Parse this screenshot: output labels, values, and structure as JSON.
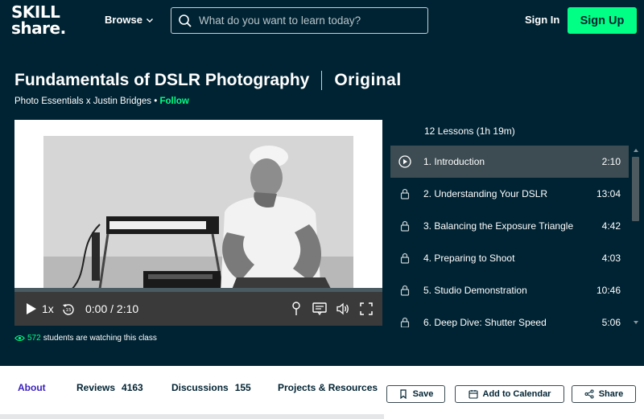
{
  "header": {
    "logo_line1": "SKILL",
    "logo_line2": "share.",
    "browse_label": "Browse",
    "search_placeholder": "What do you want to learn today?",
    "signin_label": "Sign In",
    "signup_label": "Sign Up"
  },
  "course": {
    "title": "Fundamentals of DSLR Photography",
    "badge": "Original",
    "byline": "Photo Essentials x Justin Bridges",
    "byline_sep": " • ",
    "follow_label": "Follow"
  },
  "player": {
    "speed": "1x",
    "current_time": "0:00",
    "time_sep": " / ",
    "duration": "2:10",
    "progress_fraction": 0.0
  },
  "lessons": {
    "header": "12 Lessons (1h 19m)",
    "items": [
      {
        "label": "1. Introduction",
        "duration": "2:10",
        "state": "playable"
      },
      {
        "label": "2. Understanding Your DSLR",
        "duration": "13:04",
        "state": "locked"
      },
      {
        "label": "3. Balancing the Exposure Triangle",
        "duration": "4:42",
        "state": "locked"
      },
      {
        "label": "4. Preparing to Shoot",
        "duration": "4:03",
        "state": "locked"
      },
      {
        "label": "5. Studio Demonstration",
        "duration": "10:46",
        "state": "locked"
      },
      {
        "label": "6. Deep Dive: Shutter Speed",
        "duration": "5:06",
        "state": "locked"
      }
    ]
  },
  "watching": {
    "count": "572",
    "text": "students are watching this class"
  },
  "tabs": [
    {
      "label": "About",
      "count": ""
    },
    {
      "label": "Reviews",
      "count": "4163"
    },
    {
      "label": "Discussions",
      "count": "155"
    },
    {
      "label": "Projects & Resources",
      "count": ""
    }
  ],
  "actions": {
    "save_label": "Save",
    "calendar_label": "Add to Calendar",
    "share_label": "Share"
  },
  "colors": {
    "background": "#002333",
    "accent_green": "#00ff84",
    "tab_active": "#3b21bc",
    "lesson_active": "#3d4c52"
  },
  "icons": {
    "search": "search-icon",
    "chevron": "chevron-down-icon",
    "play": "play-icon",
    "lock": "lock-icon",
    "eye": "eye-icon",
    "bookmark": "bookmark-icon",
    "calendar": "calendar-icon",
    "share": "share-icon"
  }
}
